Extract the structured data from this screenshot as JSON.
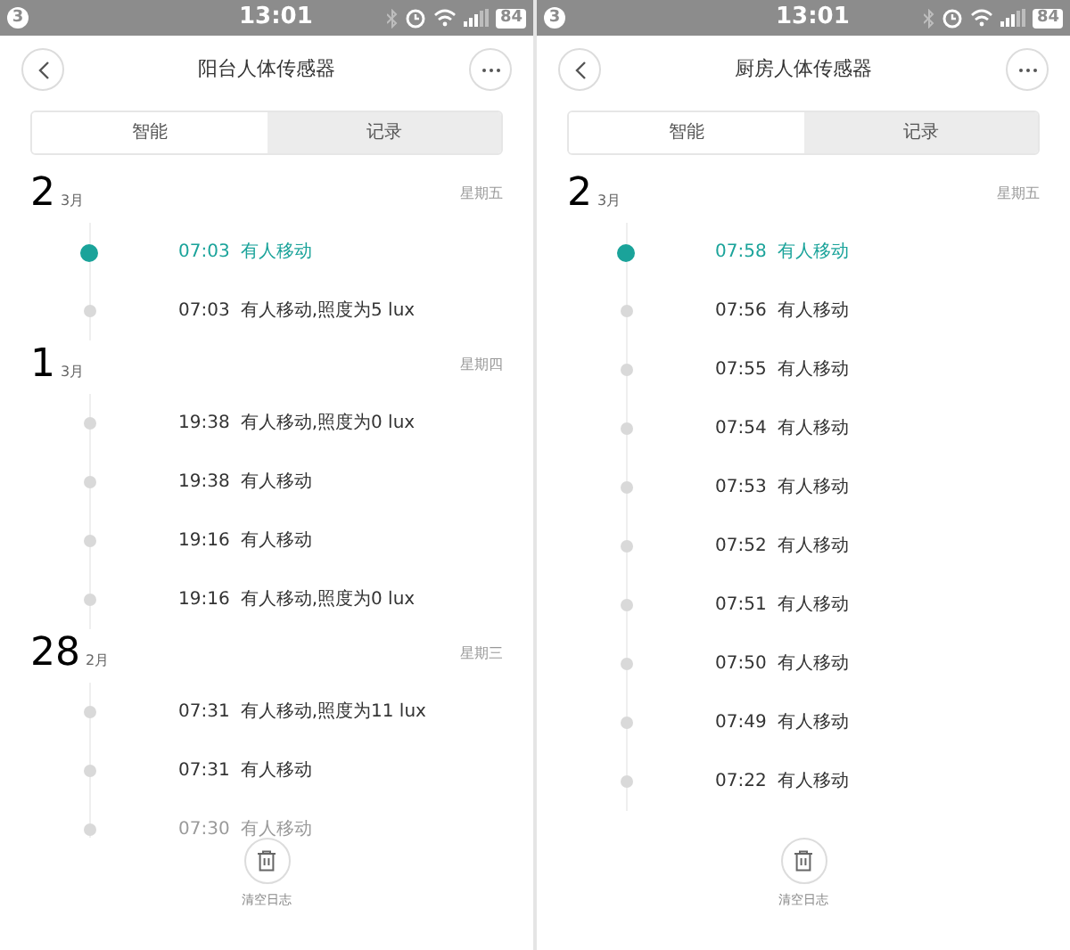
{
  "screens": [
    {
      "status_bar": {
        "badge": "3",
        "time": "13:01",
        "battery": "84"
      },
      "title": "阳台人体传感器",
      "tabs": [
        {
          "label": "智能",
          "selected": false
        },
        {
          "label": "记录",
          "selected": true
        }
      ],
      "days": [
        {
          "day": "2",
          "month": "3月",
          "weekday": "星期五",
          "events": [
            {
              "time": "07:03",
              "text": "有人移动",
              "latest": true,
              "kind": "normal"
            },
            {
              "time": "07:03",
              "text": "有人移动,照度为5 lux",
              "latest": false,
              "kind": "normal"
            }
          ]
        },
        {
          "day": "1",
          "month": "3月",
          "weekday": "星期四",
          "events": [
            {
              "time": "19:38",
              "text": "有人移动,照度为0 lux",
              "latest": false,
              "kind": "normal"
            },
            {
              "time": "19:38",
              "text": "有人移动",
              "latest": false,
              "kind": "normal"
            },
            {
              "time": "19:16",
              "text": "有人移动",
              "latest": false,
              "kind": "normal"
            },
            {
              "time": "19:16",
              "text": "有人移动,照度为0 lux",
              "latest": false,
              "kind": "normal"
            }
          ]
        },
        {
          "day": "28",
          "month": "2月",
          "weekday": "星期三",
          "events": [
            {
              "time": "07:31",
              "text": "有人移动,照度为11 lux",
              "latest": false,
              "kind": "normal"
            },
            {
              "time": "07:31",
              "text": "有人移动",
              "latest": false,
              "kind": "normal"
            },
            {
              "time": "07:30",
              "text": "有人移动",
              "latest": false,
              "kind": "faded"
            }
          ]
        }
      ],
      "clear_button": "清空日志"
    },
    {
      "status_bar": {
        "badge": "3",
        "time": "13:01",
        "battery": "84"
      },
      "title": "厨房人体传感器",
      "tabs": [
        {
          "label": "智能",
          "selected": false
        },
        {
          "label": "记录",
          "selected": true
        }
      ],
      "days": [
        {
          "day": "2",
          "month": "3月",
          "weekday": "星期五",
          "events": [
            {
              "time": "07:58",
              "text": "有人移动",
              "latest": true,
              "kind": "normal"
            },
            {
              "time": "07:56",
              "text": "有人移动",
              "latest": false,
              "kind": "normal"
            },
            {
              "time": "07:55",
              "text": "有人移动",
              "latest": false,
              "kind": "normal"
            },
            {
              "time": "07:54",
              "text": "有人移动",
              "latest": false,
              "kind": "normal"
            },
            {
              "time": "07:53",
              "text": "有人移动",
              "latest": false,
              "kind": "normal"
            },
            {
              "time": "07:52",
              "text": "有人移动",
              "latest": false,
              "kind": "normal"
            },
            {
              "time": "07:51",
              "text": "有人移动",
              "latest": false,
              "kind": "normal"
            },
            {
              "time": "07:50",
              "text": "有人移动",
              "latest": false,
              "kind": "normal"
            },
            {
              "time": "07:49",
              "text": "有人移动",
              "latest": false,
              "kind": "normal"
            },
            {
              "time": "07:22",
              "text": "有人移动",
              "latest": false,
              "kind": "normal"
            }
          ]
        }
      ],
      "clear_button": "清空日志"
    }
  ]
}
